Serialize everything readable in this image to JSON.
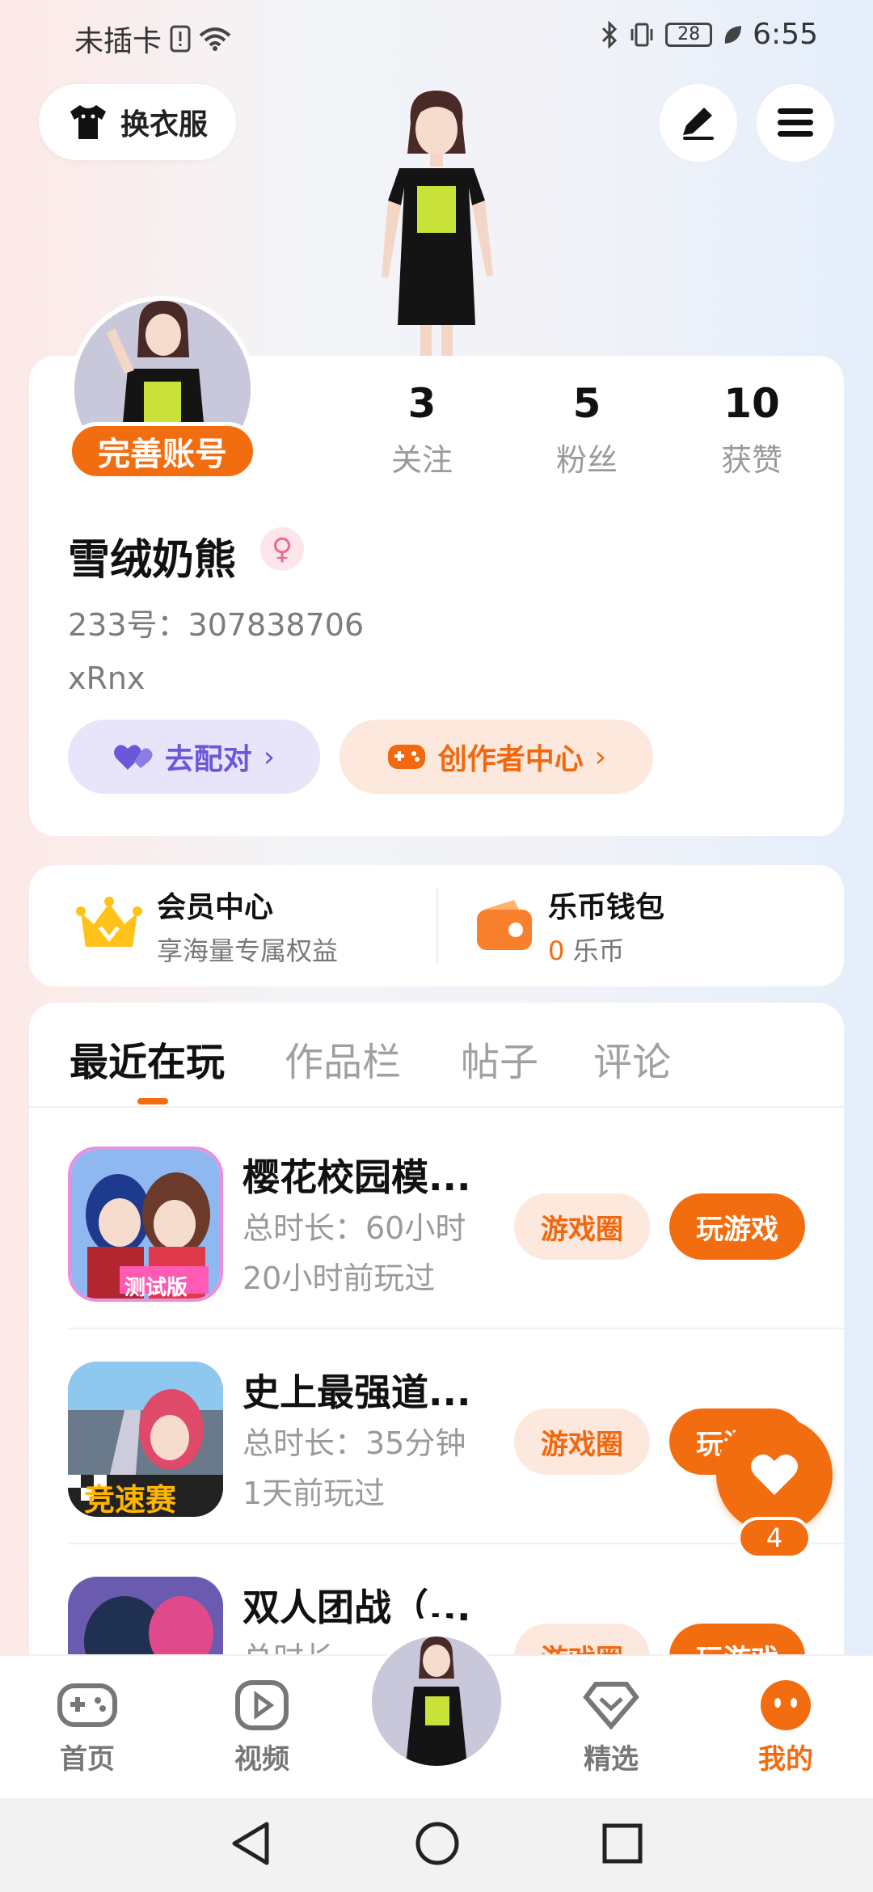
{
  "status": {
    "carrier": "未插卡",
    "battery": "28",
    "time": "6:55"
  },
  "top": {
    "outfit_label": "换衣服"
  },
  "profile": {
    "complete_badge": "完善账号",
    "stats": [
      {
        "num": "3",
        "label": "关注"
      },
      {
        "num": "5",
        "label": "粉丝"
      },
      {
        "num": "10",
        "label": "获赞"
      }
    ],
    "username": "雪绒奶熊",
    "gender_symbol": "♀",
    "uid": "233号：307838706",
    "bio": "xRnx",
    "match_label": "去配对",
    "creator_label": "创作者中心"
  },
  "member": {
    "title": "会员中心",
    "subtitle": "享海量专属权益"
  },
  "wallet": {
    "title": "乐币钱包",
    "amount": "0",
    "unit": "乐币"
  },
  "tabs": [
    "最近在玩",
    "作品栏",
    "帖子",
    "评论"
  ],
  "games": [
    {
      "title": "樱花校园模...",
      "duration": "总时长：60小时",
      "last": "20小时前玩过",
      "circle_label": "游戏圈",
      "play_label": "玩游戏",
      "icon_text": "测试版"
    },
    {
      "title": "史上最强道...",
      "duration": "总时长：35分钟",
      "last": "1天前玩过",
      "circle_label": "游戏圈",
      "play_label": "玩游戏",
      "icon_text": "竞速赛"
    },
    {
      "title": "双人团战（...",
      "duration": "总时长",
      "last": "",
      "circle_label": "游戏圈",
      "play_label": "玩游戏",
      "icon_text": ""
    }
  ],
  "float_like": {
    "count": "4"
  },
  "nav": [
    {
      "label": "首页"
    },
    {
      "label": "视频"
    },
    {
      "label": "精选"
    },
    {
      "label": "我的"
    }
  ],
  "colors": {
    "accent": "#f26d10",
    "purple": "#6a58d8"
  }
}
